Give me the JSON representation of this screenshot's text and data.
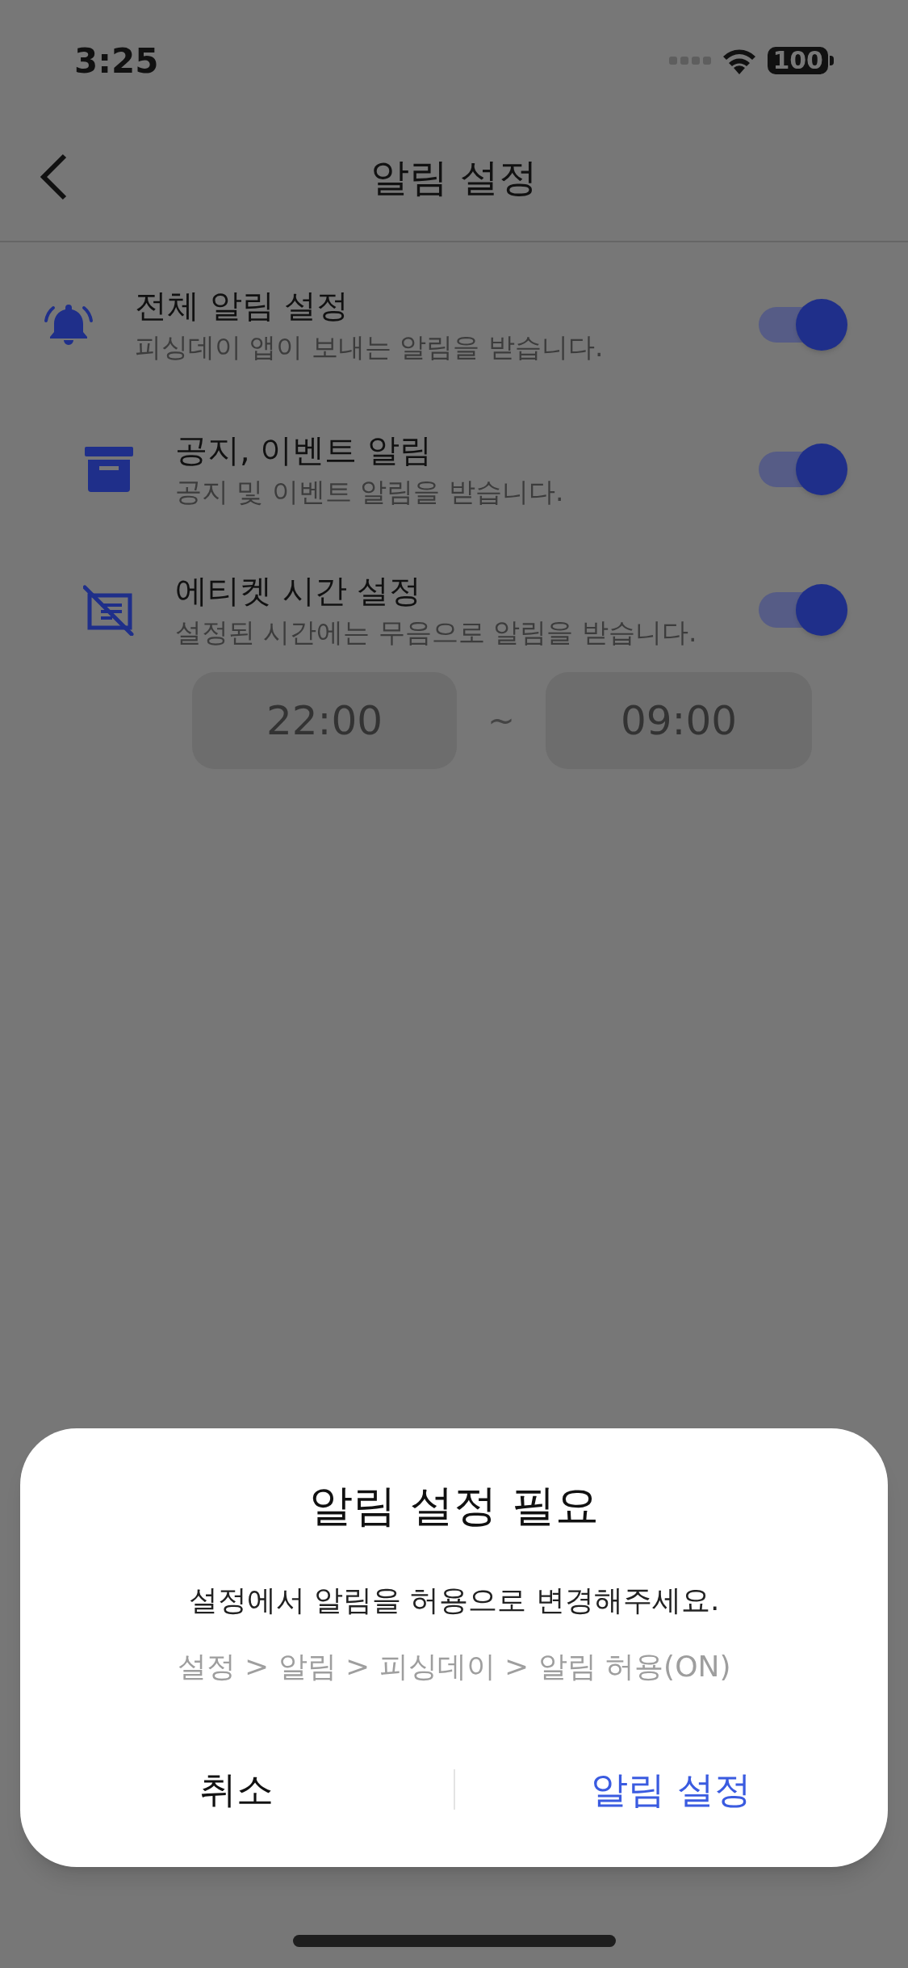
{
  "status_bar": {
    "time": "3:25",
    "battery": "100"
  },
  "header": {
    "title": "알림 설정"
  },
  "settings": [
    {
      "kind": "bell",
      "title": "전체 알림 설정",
      "description": "피싱데이 앱이 보내는 알림을 받습니다.",
      "on": true,
      "children": [
        {
          "kind": "archive",
          "title": "공지, 이벤트 알림",
          "description": "공지 및 이벤트 알림을 받습니다.",
          "on": true
        },
        {
          "kind": "mute",
          "title": "에티켓 시간 설정",
          "description": "설정된 시간에는 무음으로 알림을 받습니다.",
          "on": true,
          "time_range": {
            "start": "22:00",
            "separator": "~",
            "end": "09:00"
          }
        }
      ]
    }
  ],
  "dialog": {
    "title": "알림 설정 필요",
    "message": "설정에서 알림을 허용으로 변경해주세요.",
    "path": "설정 > 알림 > 피싱데이 > 알림 허용(ON)",
    "buttons": [
      {
        "label": "취소",
        "kind": "cancel"
      },
      {
        "label": "알림 설정",
        "kind": "confirm"
      }
    ]
  }
}
